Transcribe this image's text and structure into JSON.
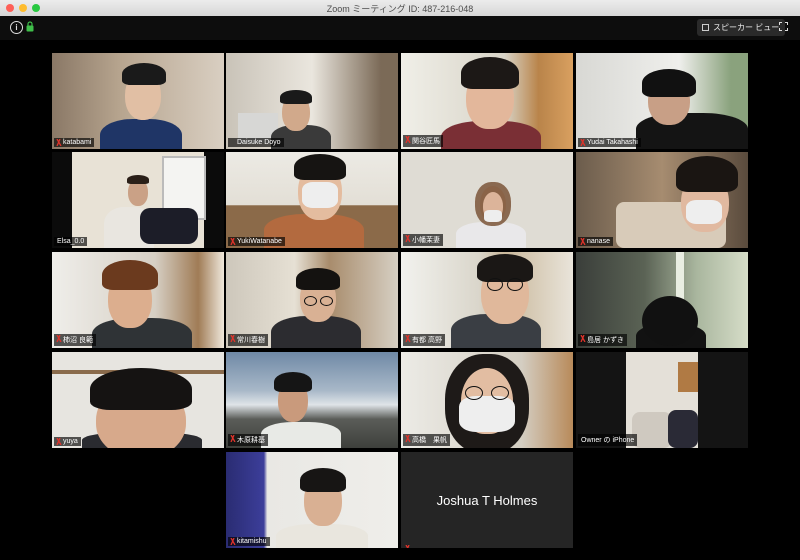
{
  "window": {
    "title": "Zoom ミーティング ID: 487-216-048"
  },
  "toolbar": {
    "speaker_view_label": "スピーカー ビュー"
  },
  "participants": [
    {
      "name": "katabami"
    },
    {
      "name": "Daisuke Doyo"
    },
    {
      "name": "関谷匠馬"
    },
    {
      "name": "Yudai Takahashi"
    },
    {
      "name": "Elsa_0.0"
    },
    {
      "name": "YukiWatanabe"
    },
    {
      "name": "小幡茉妻"
    },
    {
      "name": "nanase"
    },
    {
      "name": "柿沼 良範"
    },
    {
      "name": "常川春樹"
    },
    {
      "name": "有都 高野"
    },
    {
      "name": "島居 かずき"
    },
    {
      "name": "yuya"
    },
    {
      "name": "木原耕基"
    },
    {
      "name": "高橋　果帆"
    },
    {
      "name": "Owner の iPhone"
    },
    {
      "name": "kitamishu"
    },
    {
      "name": "Joshua T Holmes",
      "video_off": true
    }
  ],
  "colors": {
    "active_speaker_border": "#c8d84b",
    "muted_icon": "#e0332b"
  },
  "icons": [
    "info-icon",
    "lock-icon",
    "gallery-grid-icon",
    "fullscreen-icon",
    "mic-muted-icon"
  ]
}
